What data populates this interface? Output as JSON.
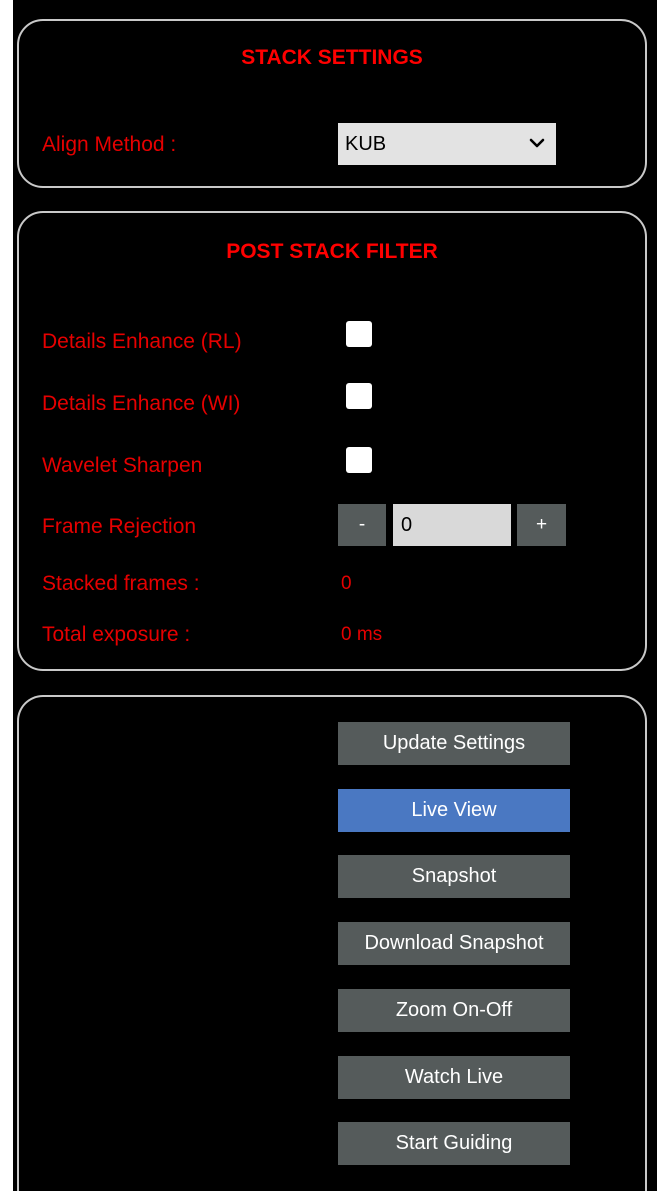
{
  "stack_settings": {
    "title": "STACK SETTINGS",
    "align_method_label": "Align Method :",
    "align_method_value": "KUB"
  },
  "post_stack_filter": {
    "title": "POST STACK FILTER",
    "details_enhance_rl_label": "Details Enhance (RL)",
    "details_enhance_rl_checked": false,
    "details_enhance_wi_label": "Details Enhance (WI)",
    "details_enhance_wi_checked": false,
    "wavelet_sharpen_label": "Wavelet Sharpen",
    "wavelet_sharpen_checked": false,
    "frame_rejection_label": "Frame Rejection",
    "frame_rejection_minus": "-",
    "frame_rejection_value": "0",
    "frame_rejection_plus": "+",
    "stacked_frames_label": "Stacked frames :",
    "stacked_frames_value": "0",
    "total_exposure_label": "Total exposure :",
    "total_exposure_value": "0 ms"
  },
  "actions": {
    "update_settings": "Update Settings",
    "live_view": "Live View",
    "snapshot": "Snapshot",
    "download_snapshot": "Download Snapshot",
    "zoom_on_off": "Zoom On-Off",
    "watch_live": "Watch Live",
    "start_guiding": "Start Guiding",
    "active_button": "live_view"
  },
  "colors": {
    "label_red": "#e60000",
    "title_red": "#ff0000",
    "button_gray": "#555b5b",
    "button_active_blue": "#4a78c2",
    "panel_border": "#c9c9c9"
  }
}
